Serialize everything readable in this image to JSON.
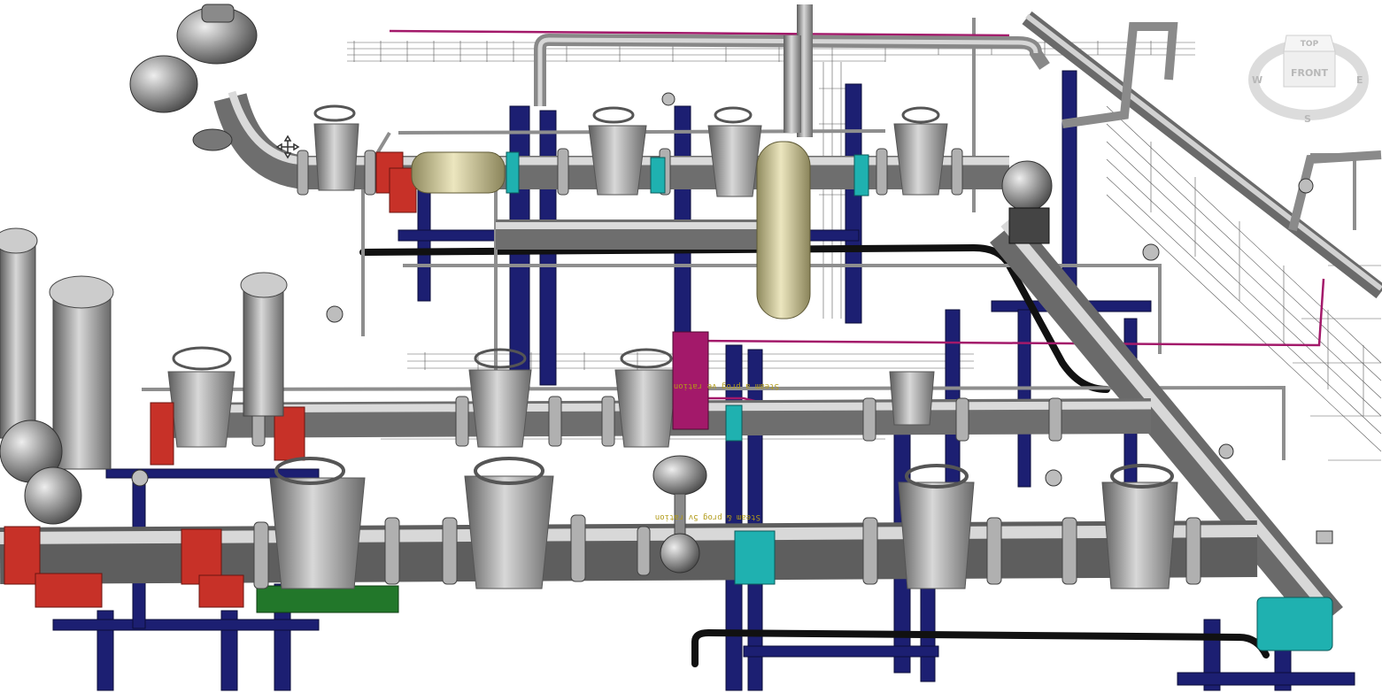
{
  "scene": {
    "colors": {
      "pipe": "#9c9c9c",
      "steel_frame": "#1c1f72",
      "flange_red": "#c73128",
      "clamp_cyan": "#1fb1b0",
      "tank_tan": "#cdc69a",
      "signal_line": "#a3196a",
      "black_pipe": "#111111",
      "green_base": "#22772a"
    },
    "labels": {
      "main_tag": "Steam & prog 5v ration",
      "mid_tag": "Steam a prog ve ration"
    }
  },
  "viewcube": {
    "top": "TOP",
    "front": "FRONT",
    "west": "W",
    "east": "E",
    "south": "S"
  },
  "cursor": {
    "icon": "move-cursor-icon"
  }
}
